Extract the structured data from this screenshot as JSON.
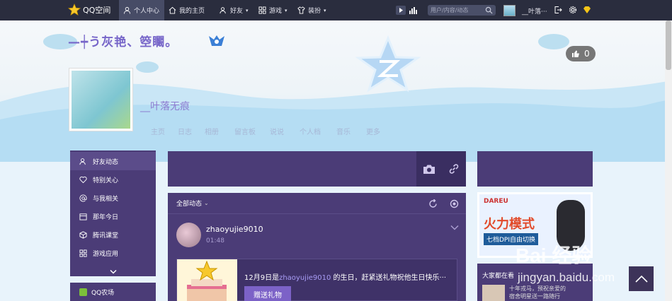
{
  "topbar": {
    "logo": "QQ空间",
    "nav": [
      {
        "label": "个人中心",
        "icon": "person-icon"
      },
      {
        "label": "我的主页",
        "icon": "home-icon"
      },
      {
        "label": "好友",
        "icon": "friends-icon"
      },
      {
        "label": "游戏",
        "icon": "grid-icon"
      },
      {
        "label": "装扮",
        "icon": "shirt-icon"
      }
    ],
    "search_placeholder": "用户/内容/动态",
    "username": "__叶落···"
  },
  "header": {
    "site_title": "—┿う灰艳、箜矙。",
    "likes": "0",
    "nickname": "__叶落无痕",
    "subnav": [
      "主页",
      "日志",
      "相册",
      "留言板",
      "说说",
      "个人档",
      "音乐",
      "更多"
    ]
  },
  "leftnav": {
    "items": [
      {
        "label": "好友动态",
        "icon": "friends-feed-icon"
      },
      {
        "label": "特别关心",
        "icon": "heart-icon"
      },
      {
        "label": "与我相关",
        "icon": "at-icon"
      },
      {
        "label": "那年今日",
        "icon": "calendar-icon"
      },
      {
        "label": "腾讯课堂",
        "icon": "cube-icon"
      },
      {
        "label": "游戏应用",
        "icon": "apps-icon"
      }
    ],
    "farm": "QQ农场"
  },
  "feed": {
    "header": "全部动态",
    "post": {
      "name": "zhaoyujie9010",
      "time": "01:48",
      "bday_prefix": "12月9日是",
      "bday_user": "zhaoyujie9010",
      "bday_suffix": " 的生日，赶紧送礼物祝他生日快乐···",
      "gift_button": "赠送礼物"
    }
  },
  "right": {
    "ad": {
      "brand": "DAREU",
      "title": "火力模式",
      "subtitle": "七档DPI自由切换"
    },
    "recommend_title": "大家都在看",
    "recommend_text1": "十年戎马，预祝亲爱的",
    "recommend_text2": "宿舍明星送一路随行"
  },
  "watermark": {
    "main": "Bai 经验",
    "sub": "jingyan.baidu.com"
  },
  "colors": {
    "topbar": "#2a2d3e",
    "panel": "#4b3c77",
    "accent": "#7766c9"
  }
}
